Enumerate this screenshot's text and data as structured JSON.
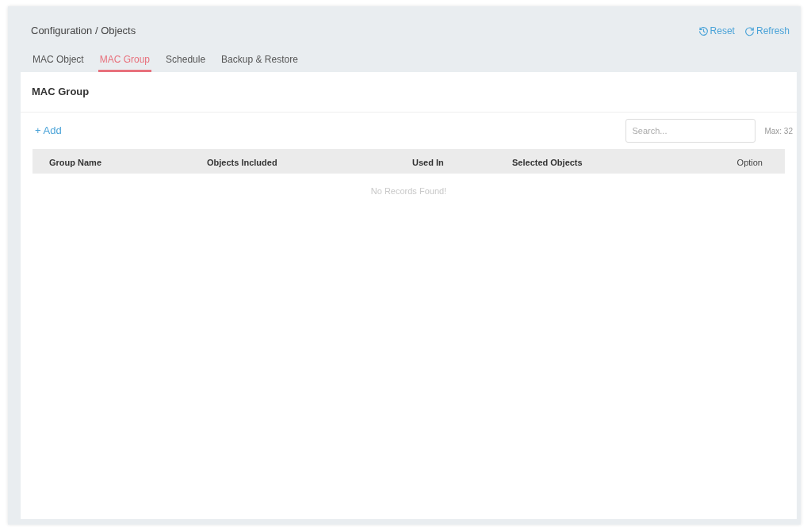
{
  "breadcrumb": "Configuration / Objects",
  "header_actions": [
    {
      "kind": "reset",
      "label": "Reset"
    },
    {
      "kind": "refresh",
      "label": "Refresh"
    }
  ],
  "tabs": [
    {
      "label": "MAC Object",
      "selected": false
    },
    {
      "label": "MAC Group",
      "selected": true
    },
    {
      "label": "Schedule",
      "selected": false
    },
    {
      "label": "Backup & Restore",
      "selected": false
    }
  ],
  "panel": {
    "title": "MAC Group",
    "add_button": "+ Add",
    "search": {
      "placeholder": "Search..."
    },
    "max_label": "Max: 32",
    "table": {
      "columns": [
        "Group Name",
        "Objects Included",
        "Used In",
        "Selected Objects",
        "Option"
      ],
      "empty_message": "No Records Found!"
    }
  }
}
